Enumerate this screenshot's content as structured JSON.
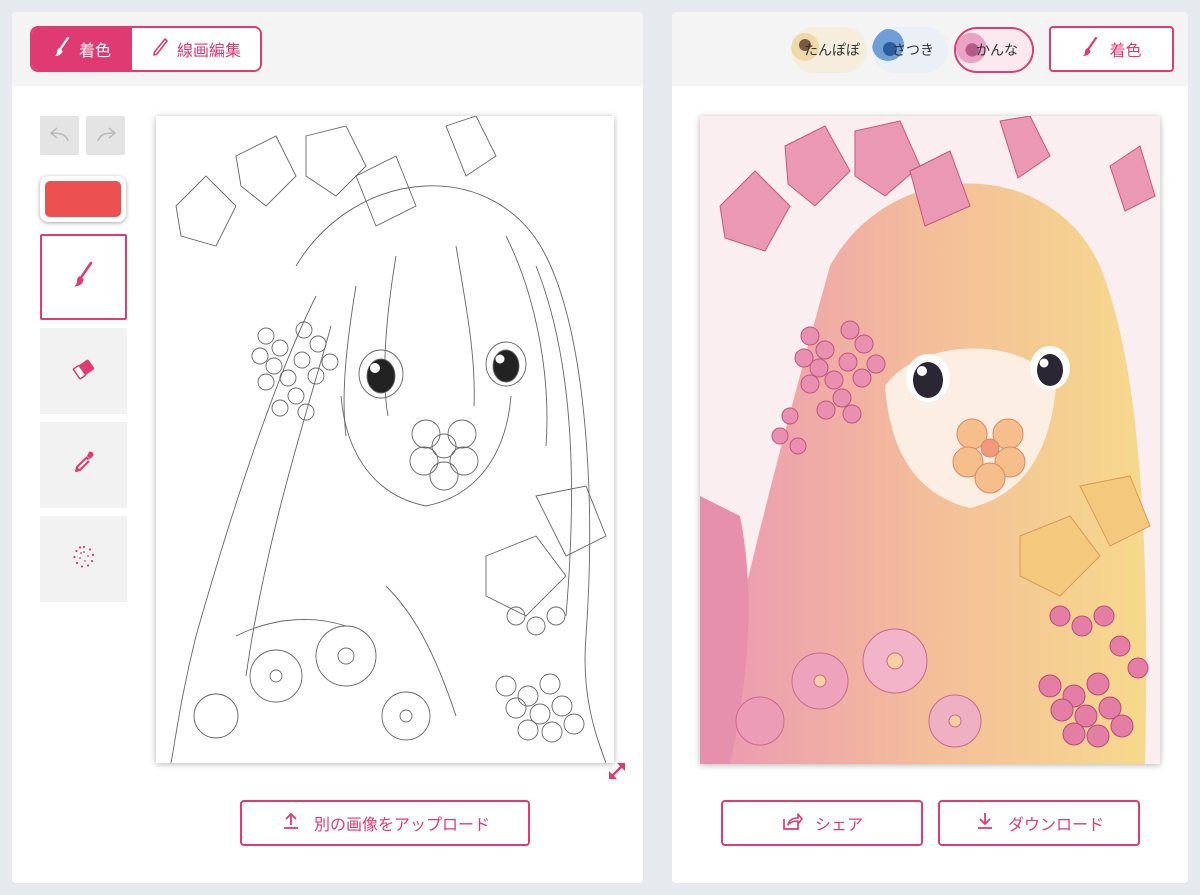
{
  "left_panel": {
    "mode_colorize_label": "着色",
    "mode_lineart_label": "線画編集",
    "current_color": "#ec5050",
    "upload_label": "別の画像をアップロード"
  },
  "right_panel": {
    "styles": [
      {
        "label": "たんぽぽ"
      },
      {
        "label": "さつき"
      },
      {
        "label": "かんな",
        "selected": true
      }
    ],
    "colorize_label": "着色",
    "share_label": "シェア",
    "download_label": "ダウンロード"
  },
  "accent_color": "#e03a73"
}
